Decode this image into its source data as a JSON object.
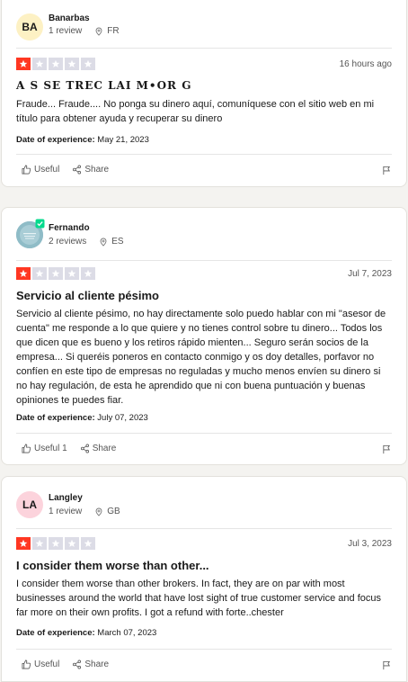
{
  "reviews": [
    {
      "avatar_initials": "BA",
      "avatar_color": "#fdf1c4",
      "name": "Banarbas",
      "review_count": "1 review",
      "country": "FR",
      "rating": 1,
      "date": "16 hours ago",
      "title": "A S SE TREC LAI M•OR G",
      "body": "Fraude... Fraude.... No ponga su dinero aquí, comuníquese con el sitio web en mi título para obtener ayuda y recuperar su dinero",
      "experience_label": "Date of experience:",
      "experience_date": "May 21, 2023",
      "useful_label": "Useful",
      "share_label": "Share"
    },
    {
      "avatar_initials": "",
      "avatar_color": "#8fbcc7",
      "name": "Fernando",
      "review_count": "2 reviews",
      "country": "ES",
      "rating": 1,
      "date": "Jul 7, 2023",
      "title": "Servicio al cliente pésimo",
      "body": "Servicio al cliente pésimo, no hay directamente solo puedo hablar con mi \"asesor de cuenta\" me responde a lo que quiere y no tienes control sobre tu dinero... Todos los que dicen que es bueno y los retiros rápido mienten... Seguro serán socios de la empresa... Si queréis poneros en contacto conmigo y os doy detalles, porfavor no confíen en este tipo de empresas no reguladas y mucho menos envíen su dinero si no hay regulación, de esta he aprendido que ni con buena puntuación y buenas opiniones te puedes fiar.",
      "experience_label": "Date of experience:",
      "experience_date": "July 07, 2023",
      "useful_label": "Useful 1",
      "share_label": "Share"
    },
    {
      "avatar_initials": "LA",
      "avatar_color": "#fcd3dc",
      "name": "Langley",
      "review_count": "1 review",
      "country": "GB",
      "rating": 1,
      "date": "Jul 3, 2023",
      "title": "I consider them worse than other...",
      "body": "I consider them worse than other brokers. In fact, they are on par with most businesses around the world that have lost sight of true customer service and focus far more on their own profits. I got a refund with forte..chester",
      "experience_label": "Date of experience:",
      "experience_date": "March 07, 2023",
      "useful_label": "Useful",
      "share_label": "Share"
    }
  ],
  "colors": {
    "star_on": "#ff3722",
    "star_off": "#dcdce6",
    "verified": "#04da8d"
  }
}
